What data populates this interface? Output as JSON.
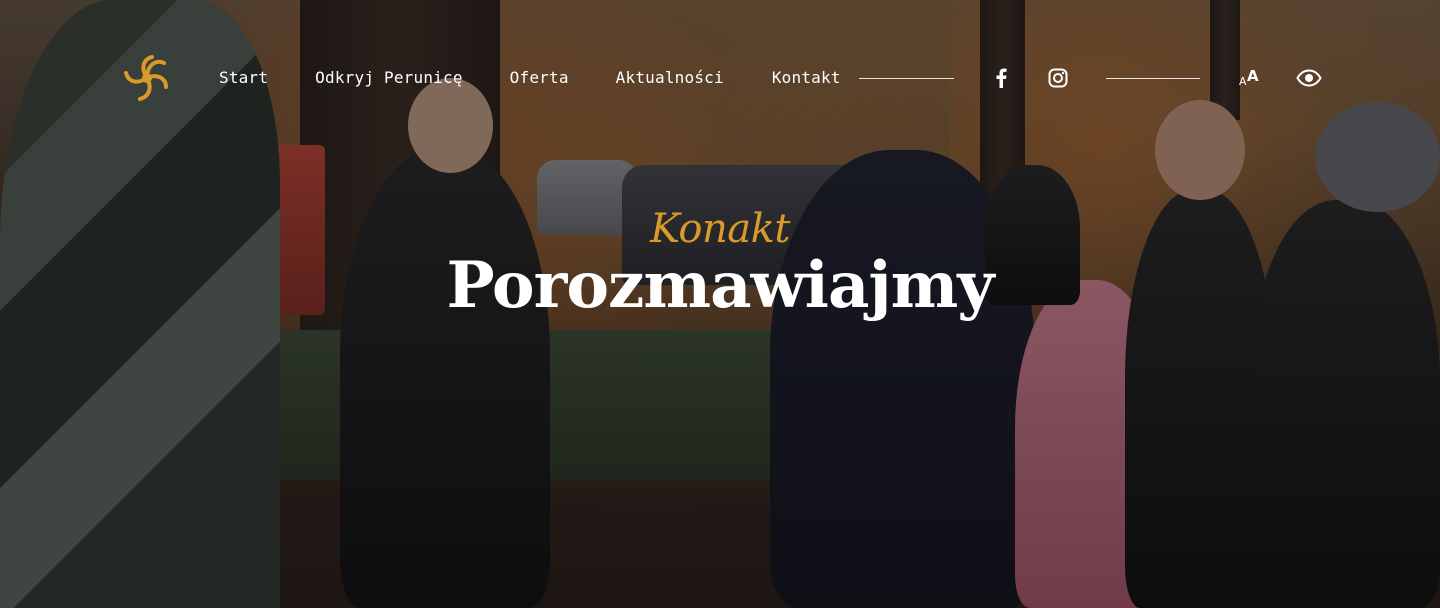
{
  "nav": {
    "items": [
      {
        "label": "Start"
      },
      {
        "label": "Odkryj Perunicę"
      },
      {
        "label": "Oferta"
      },
      {
        "label": "Aktualności"
      },
      {
        "label": "Kontakt"
      }
    ]
  },
  "icons": {
    "logo": "perunica-logo-icon",
    "facebook": "facebook-icon",
    "instagram": "instagram-icon",
    "font_size": "font-size-icon",
    "contrast": "eye-icon"
  },
  "font_size_icon": {
    "small": "A",
    "big": "A"
  },
  "hero": {
    "subtitle": "Konakt",
    "title": "Porozmawiajmy"
  },
  "colors": {
    "accent": "#d99a2c",
    "text": "#ffffff"
  }
}
